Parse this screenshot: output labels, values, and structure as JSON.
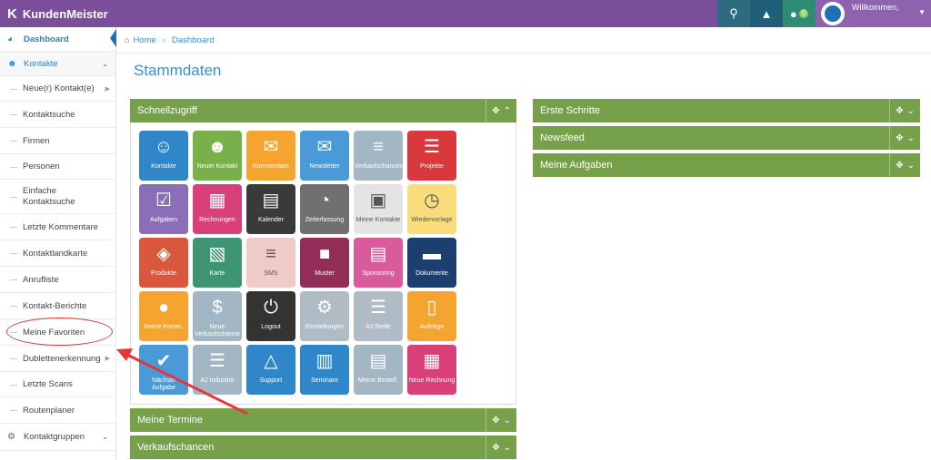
{
  "app": {
    "brand": "KundenMeister"
  },
  "topbar": {
    "chat_count": "0",
    "welcome": "Willkommen,"
  },
  "sidebar": {
    "dashboard": "Dashboard",
    "kontakte": "Kontakte",
    "items": [
      {
        "label": "Neue(r) Kontakt(e)"
      },
      {
        "label": "Kontaktsuche"
      },
      {
        "label": "Firmen"
      },
      {
        "label": "Personen"
      },
      {
        "label": "Einfache Kontaktsuche"
      },
      {
        "label": "Letzte Kommentare"
      },
      {
        "label": "Kontaktlandkarte"
      },
      {
        "label": "Anrufliste"
      },
      {
        "label": "Kontakt-Berichte"
      },
      {
        "label": "Meine Favoriten"
      },
      {
        "label": "Dublettenerkennung"
      },
      {
        "label": "Letzte Scans"
      },
      {
        "label": "Routenplaner"
      }
    ],
    "kontaktgruppen": "Kontaktgruppen"
  },
  "breadcrumb": {
    "home": "Home",
    "current": "Dashboard"
  },
  "page": {
    "title": "Stammdaten"
  },
  "panels": {
    "schnellzugriff": "Schnellzugriff",
    "meine_termine": "Meine Termine",
    "verkaufschancen": "Verkaufschancen",
    "erste_schritte": "Erste Schritte",
    "newsfeed": "Newsfeed",
    "meine_aufgaben": "Meine Aufgaben"
  },
  "tiles": [
    {
      "label": "Kontakte",
      "icon": "users-icon",
      "color": "#2f86c8"
    },
    {
      "label": "Neuer Kontakt",
      "icon": "add-user-icon",
      "color": "#78b04a"
    },
    {
      "label": "Kommentare",
      "icon": "comments-icon",
      "color": "#f5a42f"
    },
    {
      "label": "Newsletter",
      "icon": "envelope-icon",
      "color": "#4a9ad8"
    },
    {
      "label": "Verkaufschancen",
      "icon": "chart-icon",
      "color": "#a3b6c3"
    },
    {
      "label": "Projekte",
      "icon": "clipboard-icon",
      "color": "#d9393c"
    },
    {
      "label": "Aufgaben",
      "icon": "checkbox-icon",
      "color": "#8a6fb8"
    },
    {
      "label": "Rechnungen",
      "icon": "calculator-icon",
      "color": "#d9407a"
    },
    {
      "label": "Kalender",
      "icon": "calendar-icon",
      "color": "#3a3a3a"
    },
    {
      "label": "Zeiterfassung",
      "icon": "stopwatch-icon",
      "color": "#707070"
    },
    {
      "label": "Meine Kontakte",
      "icon": "address-book-icon",
      "color": "#e4e4e4"
    },
    {
      "label": "Wiedervorlage",
      "icon": "clock-icon",
      "color": "#f9dc7c"
    },
    {
      "label": "Produkte",
      "icon": "tag-icon",
      "color": "#d9573d"
    },
    {
      "label": "Karte",
      "icon": "map-icon",
      "color": "#3f9473"
    },
    {
      "label": "SMS",
      "icon": "sms-icon",
      "color": "#f0cac6"
    },
    {
      "label": "Muster",
      "icon": "box-icon",
      "color": "#922e58"
    },
    {
      "label": "Sponsoring",
      "icon": "sponsoring-icon",
      "color": "#d85c9c"
    },
    {
      "label": "Dokumente",
      "icon": "folder-icon",
      "color": "#1c3f70"
    },
    {
      "label": "Meine Komm.",
      "icon": "speech-bubble-icon",
      "color": "#f5a42f"
    },
    {
      "label": "Neue Verkaufschance",
      "icon": "dollar-icon",
      "color": "#a3b6c3"
    },
    {
      "label": "Logout",
      "icon": "power-icon",
      "color": "#333333"
    },
    {
      "label": "Einstellungen",
      "icon": "gears-icon",
      "color": "#b0bcc5"
    },
    {
      "label": "AJ Stelle",
      "icon": "list-icon",
      "color": "#b0bcc5"
    },
    {
      "label": "Aufträge",
      "icon": "document-icon",
      "color": "#f5a42f"
    },
    {
      "label": "Nächste Aufgabe",
      "icon": "check-icon",
      "color": "#4a9ad8"
    },
    {
      "label": "AJ Industrie",
      "icon": "list-icon",
      "color": "#a3b6c3"
    },
    {
      "label": "Support",
      "icon": "bell-icon",
      "color": "#2f86c8"
    },
    {
      "label": "Seminare",
      "icon": "book-icon",
      "color": "#2f86c8"
    },
    {
      "label": "Meine Bestell.",
      "icon": "cart-icon",
      "color": "#a3b6c3"
    },
    {
      "label": "Neue Rechnung",
      "icon": "calculator-icon",
      "color": "#d9407a"
    }
  ]
}
